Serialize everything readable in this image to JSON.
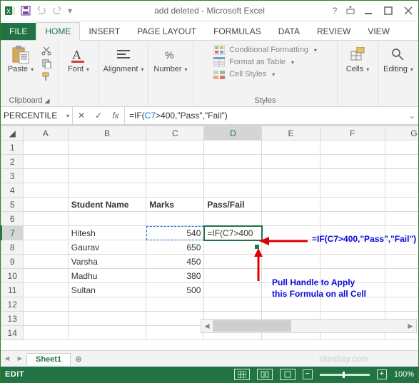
{
  "title": "add deleted - Microsoft Excel",
  "tabs": {
    "file": "FILE",
    "home": "HOME",
    "insert": "INSERT",
    "pagelayout": "PAGE LAYOUT",
    "formulas": "FORMULAS",
    "data": "DATA",
    "review": "REVIEW",
    "view": "VIEW"
  },
  "ribbon": {
    "clipboard": {
      "label": "Clipboard",
      "paste": "Paste"
    },
    "font": {
      "label": "Font",
      "btn": "Font"
    },
    "alignment": {
      "label": "Alignment",
      "btn": "Alignment"
    },
    "number": {
      "label": "Number",
      "btn": "Number"
    },
    "styles": {
      "label": "Styles",
      "cond": "Conditional Formatting",
      "table": "Format as Table",
      "cell": "Cell Styles"
    },
    "cells": {
      "label": "Cells",
      "btn": "Cells"
    },
    "editing": {
      "label": "Editing",
      "btn": "Editing"
    }
  },
  "namebox": "PERCENTILE",
  "formula_prefix": "=IF(",
  "formula_ref": "C7",
  "formula_suffix": ">400,\"Pass\",\"Fail\")",
  "columns": [
    "A",
    "B",
    "C",
    "D",
    "E",
    "F",
    "G"
  ],
  "rows": [
    "1",
    "2",
    "3",
    "4",
    "5",
    "6",
    "7",
    "8",
    "9",
    "10",
    "11",
    "12",
    "13",
    "14"
  ],
  "header": {
    "b": "Student Name",
    "c": "Marks",
    "d": "Pass/Fail"
  },
  "data": {
    "b7": "Hitesh",
    "c7": "540",
    "d7": "=IF(C7>400",
    "b8": "Gaurav",
    "c8": "650",
    "b9": "Varsha",
    "c9": "450",
    "b10": "Madhu",
    "c10": "380",
    "b11": "Sultan",
    "c11": "500"
  },
  "annotation": {
    "formula": "=IF(C7>400,\"Pass\",\"Fail\")",
    "pull1": "Pull Handle to Apply",
    "pull2": "this Formula on all Cell"
  },
  "sheet": "Sheet1",
  "watermark": "sitesbay.com",
  "status": {
    "mode": "EDIT",
    "zoom": "100%"
  }
}
